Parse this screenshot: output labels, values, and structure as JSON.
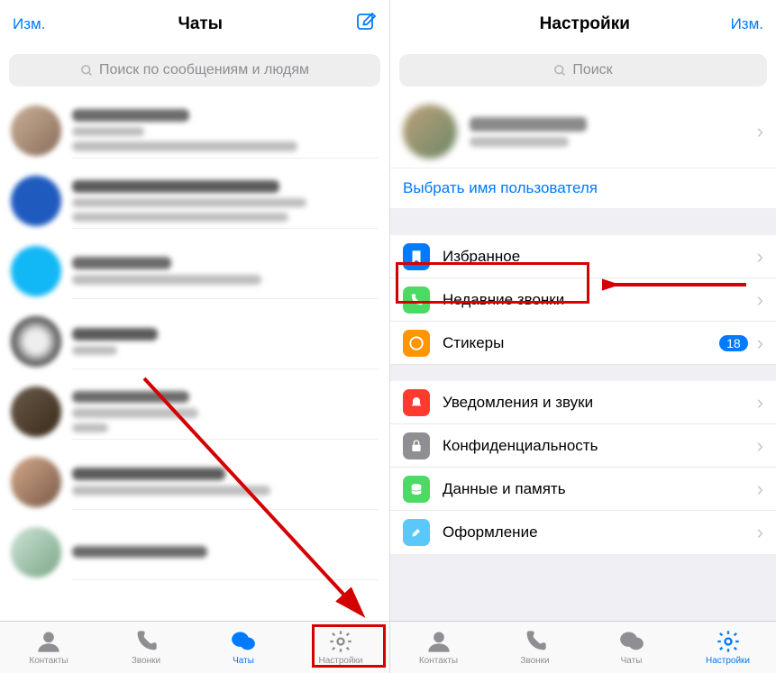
{
  "left": {
    "nav": {
      "edit": "Изм.",
      "title": "Чаты"
    },
    "search_placeholder": "Поиск по сообщениям и людям",
    "tabs": {
      "contacts": "Контакты",
      "calls": "Звонки",
      "chats": "Чаты",
      "settings": "Настройки"
    }
  },
  "right": {
    "nav": {
      "edit": "Изм.",
      "title": "Настройки"
    },
    "search_placeholder": "Поиск",
    "choose_username": "Выбрать имя пользователя",
    "items": {
      "favorites": "Избранное",
      "recent_calls": "Недавние звонки",
      "stickers": "Стикеры",
      "stickers_badge": "18",
      "notifications": "Уведомления и звуки",
      "privacy": "Конфиденциальность",
      "data": "Данные и память",
      "appearance": "Оформление"
    },
    "tabs": {
      "contacts": "Контакты",
      "calls": "Звонки",
      "chats": "Чаты",
      "settings": "Настройки"
    }
  },
  "icon_colors": {
    "favorites": "#007aff",
    "recent_calls": "#4cd964",
    "stickers": "#ff9500",
    "notifications": "#ff3b30",
    "privacy": "#8e8e93",
    "data": "#4cd964",
    "appearance": "#5ac8fa"
  }
}
